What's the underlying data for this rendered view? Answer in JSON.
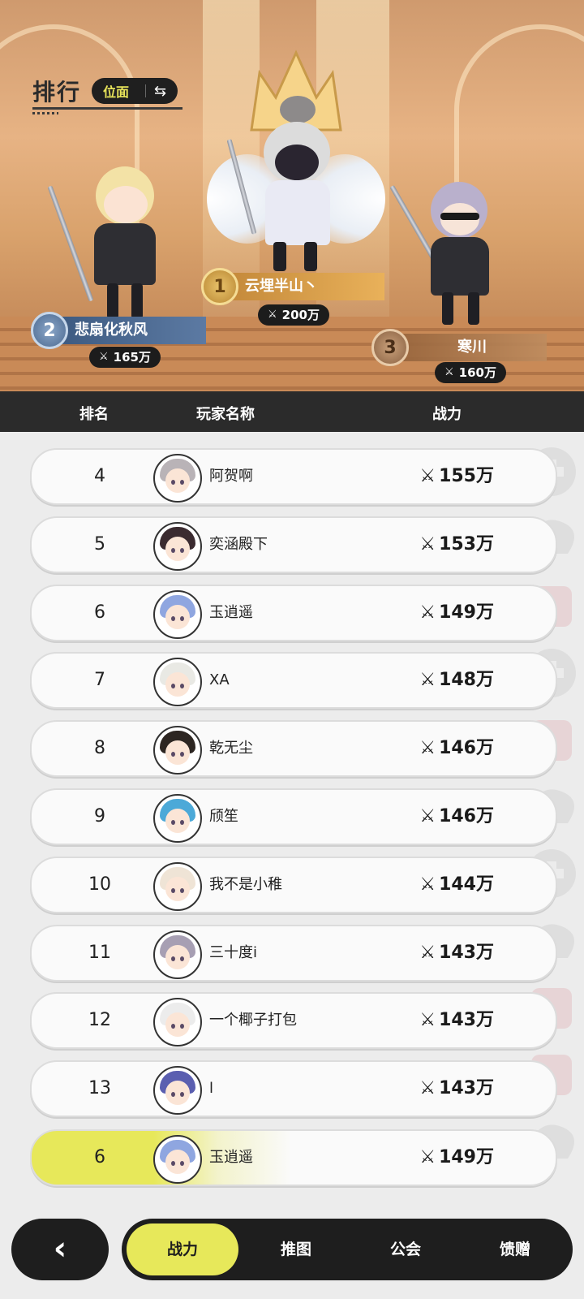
{
  "header": {
    "title": "排行",
    "plane_label": "位面",
    "swap_icon": "swap-icon"
  },
  "podium": [
    {
      "rank": "1",
      "name": "云埋半山丶",
      "power": "200万"
    },
    {
      "rank": "2",
      "name": "悲扇化秋风",
      "power": "165万"
    },
    {
      "rank": "3",
      "name": "寒川",
      "power": "160万"
    }
  ],
  "columns": {
    "rank": "排名",
    "name": "玩家名称",
    "power": "战力"
  },
  "rows": [
    {
      "rank": "4",
      "name": "阿贺啊",
      "power": "155万",
      "hair": "#b9b3b7"
    },
    {
      "rank": "5",
      "name": "奕涵殿下",
      "power": "153万",
      "hair": "#3b2b30"
    },
    {
      "rank": "6",
      "name": "玉逍遥",
      "power": "149万",
      "hair": "#8fa6e0"
    },
    {
      "rank": "7",
      "name": "XA",
      "power": "148万",
      "hair": "#e9e9e4"
    },
    {
      "rank": "8",
      "name": "乾无尘",
      "power": "146万",
      "hair": "#2d2622"
    },
    {
      "rank": "9",
      "name": "颀笙",
      "power": "146万",
      "hair": "#4ca9d8"
    },
    {
      "rank": "10",
      "name": "我不是小稚",
      "power": "144万",
      "hair": "#efe4d6"
    },
    {
      "rank": "11",
      "name": "三十度i",
      "power": "143万",
      "hair": "#a79fb3"
    },
    {
      "rank": "12",
      "name": "一个椰子打包",
      "power": "143万",
      "hair": "#ececec"
    },
    {
      "rank": "13",
      "name": "l",
      "power": "143万",
      "hair": "#5b5fb0"
    }
  ],
  "self_row": {
    "rank": "6",
    "name": "玉逍遥",
    "power": "149万",
    "hair": "#8fa6e0"
  },
  "nav": {
    "back_icon": "chevron-left-icon",
    "tabs": [
      "战力",
      "推图",
      "公会",
      "馈赠"
    ],
    "active_tab": 0
  },
  "colors": {
    "accent": "#e7e85a",
    "dark": "#1e1e1e",
    "gold": "#d7a760"
  }
}
